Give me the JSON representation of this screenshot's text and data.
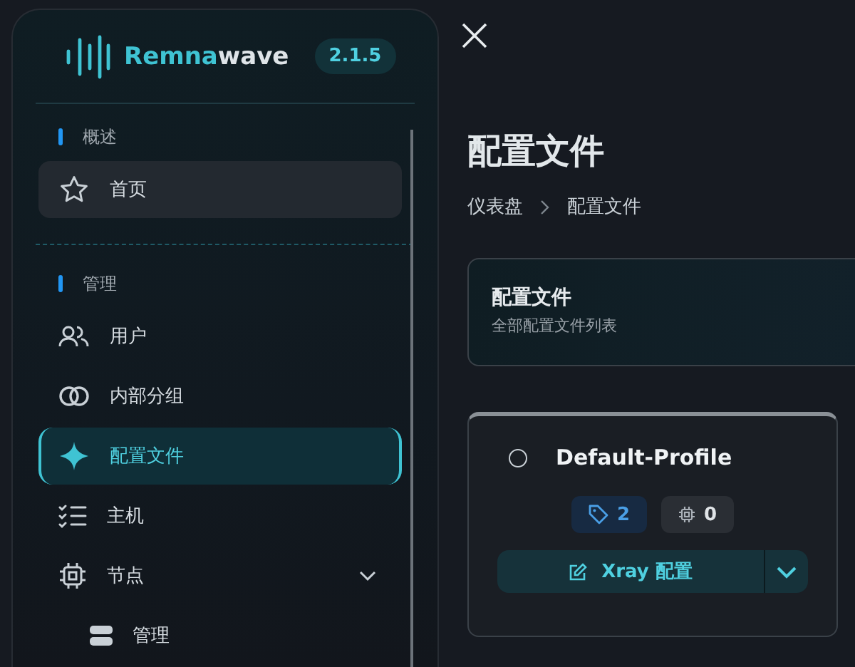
{
  "sidebar": {
    "logo": {
      "name_main": "Remna",
      "name_rest": "wave",
      "version": "2.1.5"
    },
    "sections": [
      {
        "title": "概述",
        "items": [
          {
            "label": "首页",
            "selected": false,
            "hovered": true
          }
        ]
      },
      {
        "title": "管理",
        "items": [
          {
            "label": "用户",
            "selected": false,
            "hovered": false
          },
          {
            "label": "内部分组",
            "selected": false,
            "hovered": false
          },
          {
            "label": "配置文件",
            "selected": true,
            "hovered": false
          },
          {
            "label": "主机",
            "selected": false,
            "hovered": false
          },
          {
            "label": "节点",
            "selected": false,
            "hovered": false,
            "expanded": true,
            "children": [
              {
                "label": "管理",
                "selected": false,
                "hovered": false
              }
            ]
          }
        ]
      }
    ]
  },
  "main": {
    "title": "配置文件",
    "breadcrumb": [
      "仪表盘",
      "配置文件"
    ],
    "header_card": {
      "title": "配置文件",
      "subtitle": "全部配置文件列表"
    },
    "profiles": [
      {
        "name": "Default-Profile",
        "selected": false,
        "inbounds": "2",
        "nodes": "0",
        "action": "Xray 配置"
      }
    ]
  }
}
